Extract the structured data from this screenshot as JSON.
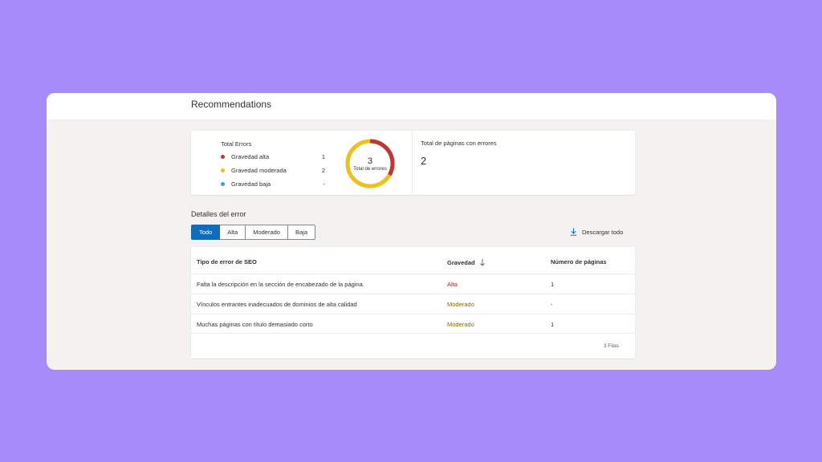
{
  "page": {
    "title": "Recommendations"
  },
  "summary": {
    "errors_title": "Total Errors",
    "legend": [
      {
        "label": "Gravedad alta",
        "value": "1",
        "color": "#c13535"
      },
      {
        "label": "Gravedad moderada",
        "value": "2",
        "color": "#f0c01a"
      },
      {
        "label": "Gravedad baja",
        "value": "-",
        "color": "#23b0c8"
      }
    ],
    "donut": {
      "total": "3",
      "label": "Total de errores",
      "segments": [
        1,
        2,
        0
      ]
    },
    "pages_title": "Total de páginas con errores",
    "pages_value": "2"
  },
  "details": {
    "title": "Detalles del error",
    "tabs": [
      "Todo",
      "Alta",
      "Moderado",
      "Baja"
    ],
    "active_tab": "Todo",
    "download_label": "Descargar todo",
    "columns": [
      "Tipo de error de SEO",
      "Gravedad",
      "Número de páginas"
    ],
    "rows": [
      {
        "type": "Falta la descripción en la sección de encabezado de la página.",
        "severity": "Alta",
        "pages": "1"
      },
      {
        "type": "Vínculos entrantes inadecuados de dominios de alta calidad",
        "severity": "Moderado",
        "pages": "-"
      },
      {
        "type": "Muchas páginas con título demasiado corto",
        "severity": "Moderado",
        "pages": "1"
      }
    ],
    "row_count": "3 Filas"
  }
}
